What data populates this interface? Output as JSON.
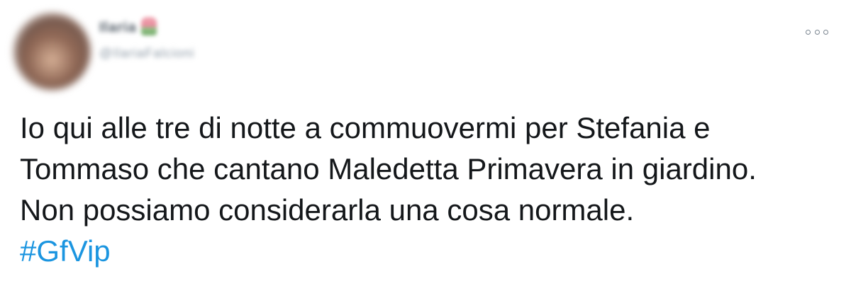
{
  "tweet": {
    "author": {
      "name": "Ilaria",
      "handle": "@IlariaFalcioni",
      "avatar_icon": "user-avatar-icon",
      "name_emoji_icon": "tulip-emoji-icon"
    },
    "menu_icon": "more-options-icon",
    "text": "Io qui alle tre di notte a commuovermi per Stefania e\nTommaso che cantano Maledetta Primavera in giardino.\nNon possiamo considerarla una cosa normale.",
    "hashtag": "#GfVip"
  },
  "colors": {
    "text": "#14171a",
    "hashtag": "#1b95e0",
    "icon": "#7b8690",
    "handle": "#8d9aa6"
  }
}
